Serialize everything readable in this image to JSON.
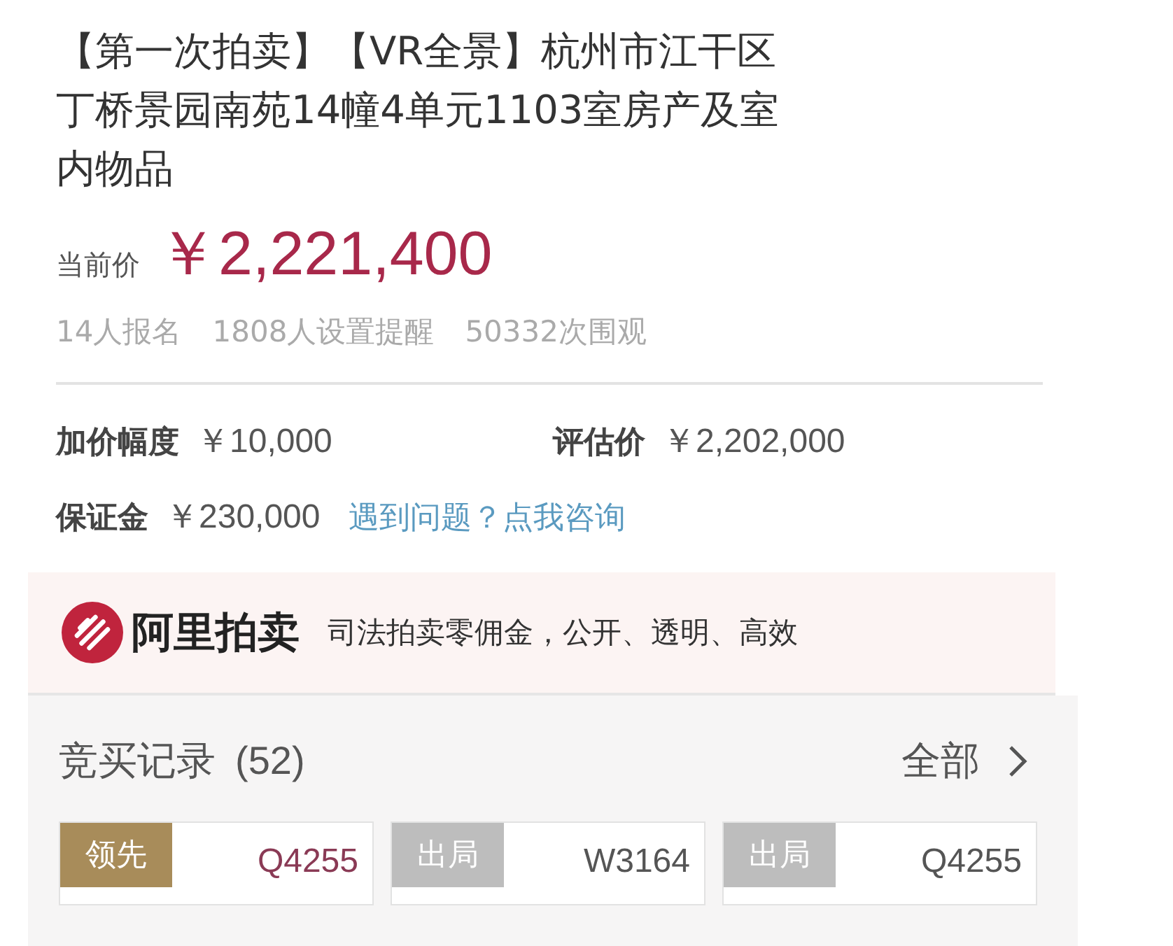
{
  "title": "【第一次拍卖】【VR全景】杭州市江干区丁桥景园南苑14幢4单元1103室房产及室内物品",
  "price": {
    "label": "当前价",
    "value": "￥2,221,400"
  },
  "stats": [
    "14人报名",
    "1808人设置提醒",
    "50332次围观"
  ],
  "info": [
    {
      "label": "加价幅度",
      "value": "￥10,000"
    },
    {
      "label": "评估价",
      "value": "￥2,202,000"
    },
    {
      "label": "保证金",
      "value": "￥230,000"
    }
  ],
  "help_link": "遇到问题？点我咨询",
  "banner": {
    "brand": "阿里拍卖",
    "slogan": "司法拍卖零佣金，公开、透明、高效"
  },
  "records": {
    "title": "竞买记录",
    "count": "(52)",
    "all": "全部",
    "items": [
      {
        "kind": "leading",
        "status": "领先",
        "bidder": "Q4255"
      },
      {
        "kind": "out",
        "status": "出局",
        "bidder": "W3164"
      },
      {
        "kind": "out",
        "status": "出局",
        "bidder": "Q4255"
      }
    ]
  }
}
